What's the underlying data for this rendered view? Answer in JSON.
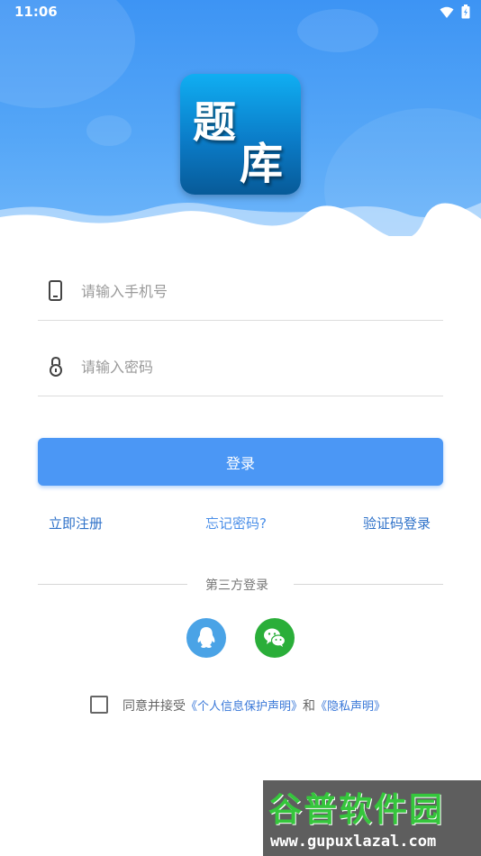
{
  "status_bar": {
    "time": "11:06",
    "icons": [
      "wifi-icon",
      "battery-icon"
    ]
  },
  "logo": {
    "char1": "题",
    "char2": "库"
  },
  "form": {
    "phone_placeholder": "请输入手机号",
    "password_placeholder": "请输入密码",
    "phone_icon": "phone-icon",
    "password_icon": "lock-icon"
  },
  "login_button": "登录",
  "links": {
    "register": "立即注册",
    "forgot": "忘记密码?",
    "sms_login": "验证码登录"
  },
  "third_party": {
    "title": "第三方登录",
    "icons": [
      "qq-icon",
      "wechat-icon"
    ]
  },
  "agreement": {
    "prefix": "同意并接受",
    "personal_info": "《个人信息保护声明》",
    "and": "和",
    "privacy": "《隐私声明》"
  },
  "watermark": {
    "name": "谷普软件园",
    "url": "www.gupuxlazal.com"
  },
  "colors": {
    "header": "#3d94f4",
    "button": "#4b97f5",
    "link": "#2f72c9",
    "qq": "#4aa3e6",
    "wechat": "#2aae39"
  }
}
